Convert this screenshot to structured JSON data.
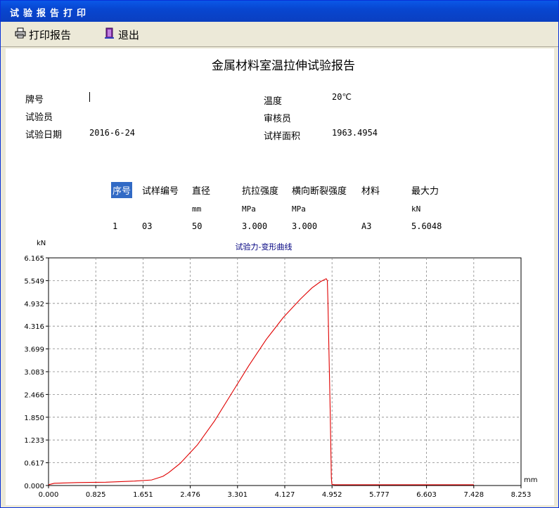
{
  "window": {
    "title": "试验报告打印"
  },
  "toolbar": {
    "print_label": "打印报告",
    "exit_label": "退出",
    "print_icon": "printer-icon",
    "exit_icon": "exit-door-icon"
  },
  "report": {
    "title": "金属材料室温拉伸试验报告",
    "fields": {
      "brand_label": "牌号",
      "brand_value": "",
      "temp_label": "温度",
      "temp_value": "20℃",
      "tester_label": "试验员",
      "tester_value": "",
      "reviewer_label": "审核员",
      "reviewer_value": "",
      "date_label": "试验日期",
      "date_value": "2016-6-24",
      "area_label": "试样面积",
      "area_value": "1963.4954"
    },
    "table": {
      "headers": [
        "序号",
        "试样编号",
        "直径",
        "抗拉强度",
        "横向断裂强度",
        "材料",
        "最大力"
      ],
      "units": [
        "",
        "",
        "mm",
        "MPa",
        "MPa",
        "",
        "kN"
      ],
      "rows": [
        [
          "1",
          "03",
          "50",
          "3.000",
          "3.000",
          "A3",
          "5.6048"
        ]
      ]
    }
  },
  "chart_data": {
    "type": "line",
    "title": "试验力-变形曲线",
    "ylabel": "kN",
    "xlabel": "mm",
    "xlim": [
      0,
      8.253
    ],
    "ylim": [
      0,
      6.165
    ],
    "x_ticks": [
      "0.000",
      "0.825",
      "1.651",
      "2.476",
      "3.301",
      "4.127",
      "4.952",
      "5.777",
      "6.603",
      "7.428",
      "8.253"
    ],
    "y_ticks": [
      "6.165",
      "5.549",
      "4.932",
      "4.316",
      "3.699",
      "3.083",
      "2.466",
      "1.850",
      "1.233",
      "0.617",
      "0.000"
    ],
    "grid": true,
    "line_color": "#e00000",
    "series": [
      {
        "x": [
          0.0,
          0.1,
          0.5,
          1.0,
          1.5,
          1.8,
          2.0,
          2.1,
          2.3,
          2.6,
          2.9,
          3.2,
          3.5,
          3.8,
          4.1,
          4.4,
          4.6,
          4.75,
          4.85,
          4.87,
          4.88,
          4.92,
          4.94,
          4.95,
          5.0,
          6.0,
          7.0,
          7.43
        ],
        "y": [
          0.02,
          0.06,
          0.08,
          0.09,
          0.12,
          0.15,
          0.25,
          0.35,
          0.6,
          1.1,
          1.75,
          2.5,
          3.25,
          3.95,
          4.55,
          5.05,
          5.35,
          5.52,
          5.6,
          5.55,
          5.0,
          2.0,
          0.2,
          0.03,
          0.02,
          0.02,
          0.02,
          0.02
        ]
      }
    ]
  }
}
